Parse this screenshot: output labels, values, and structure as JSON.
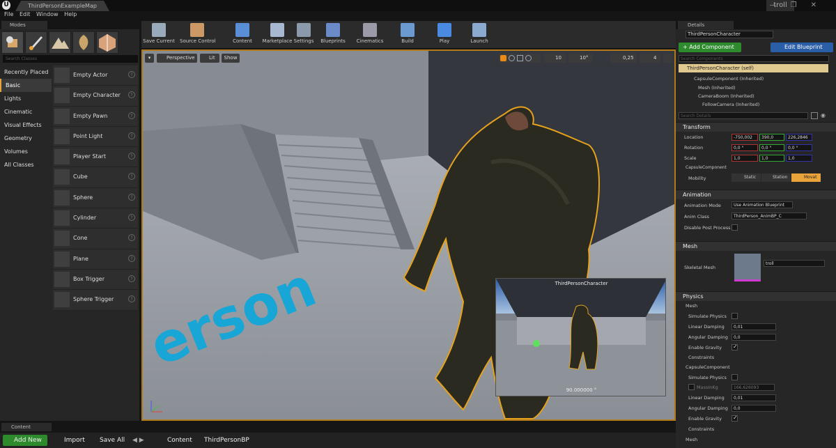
{
  "window": {
    "title": "ThirdPersonExampleMap",
    "user": "troll",
    "controls": [
      "—",
      "❐",
      "✕"
    ]
  },
  "menu": [
    "File",
    "Edit",
    "Window",
    "Help"
  ],
  "modes": {
    "tab": "Modes",
    "search_placeholder": "Search Classes",
    "categories": [
      "Recently Placed",
      "Basic",
      "Lights",
      "Cinematic",
      "Visual Effects",
      "Geometry",
      "Volumes",
      "All Classes"
    ],
    "selected_category": "Basic",
    "classes": [
      "Empty Actor",
      "Empty Character",
      "Empty Pawn",
      "Point Light",
      "Player Start",
      "Cube",
      "Sphere",
      "Cylinder",
      "Cone",
      "Plane",
      "Box Trigger",
      "Sphere Trigger"
    ]
  },
  "toolbar": [
    {
      "label": "Save Current",
      "icon": "save-icon"
    },
    {
      "label": "Source Control",
      "icon": "source-control-icon"
    },
    {
      "label": "Content",
      "icon": "content-icon"
    },
    {
      "label": "Marketplace",
      "icon": "marketplace-icon"
    },
    {
      "label": "Settings",
      "icon": "settings-icon"
    },
    {
      "label": "Blueprints",
      "icon": "blueprints-icon"
    },
    {
      "label": "Cinematics",
      "icon": "cinematics-icon"
    },
    {
      "label": "Build",
      "icon": "build-icon"
    },
    {
      "label": "Play",
      "icon": "play-icon"
    },
    {
      "label": "Launch",
      "icon": "launch-icon"
    }
  ],
  "viewport": {
    "perspective": "Perspective",
    "lit": "Lit",
    "show": "Show",
    "grid_snap": "10",
    "rot_snap": "10°",
    "scale_snap": "0,25",
    "camera_speed": "4",
    "floor_text": "erson",
    "preview_title": "ThirdPersonCharacter",
    "preview_footer": "90.000000 °"
  },
  "content_browser": {
    "tab": "Content Browser",
    "add_new": "Add New",
    "import": "Import",
    "save_all": "Save All",
    "path": [
      "Content",
      "ThirdPersonBP"
    ]
  },
  "details": {
    "tab": "Details",
    "actor_name": "ThirdPersonCharacter",
    "add_component": "+ Add Component",
    "edit_blueprint": "Edit Blueprint",
    "search_components": "Search Components",
    "components": [
      "ThirdPersonCharacter (self)",
      "CapsuleComponent (Inherited)",
      "Mesh (Inherited)",
      "CameraBoom (Inherited)",
      "FollowCamera (Inherited)"
    ],
    "search_details": "Search Details",
    "transform": {
      "title": "Transform",
      "location_label": "Location",
      "location": [
        "-750,002",
        "390,0",
        "226,2846"
      ],
      "rotation_label": "Rotation",
      "rotation": [
        "0,0 °",
        "0,0 °",
        "0,0 °"
      ],
      "scale_label": "Scale",
      "scale": [
        "1,0",
        "1,0",
        "1,0"
      ],
      "capsule_label": "CapsuleComponent",
      "mobility_label": "Mobility",
      "mobility": [
        "Static",
        "Station",
        "Movat"
      ]
    },
    "animation": {
      "title": "Animation",
      "mode_label": "Animation Mode",
      "mode": "Use Animation Blueprint",
      "class_label": "Anim Class",
      "class": "ThirdPerson_AnimBP_C",
      "disable_label": "Disable Post Process"
    },
    "mesh": {
      "title": "Mesh",
      "skeletal_label": "Skeletal Mesh",
      "skeletal": "troll"
    },
    "physics": {
      "title": "Physics",
      "mesh_sub": "Mesh",
      "simulate": "Simulate Physics",
      "linear": "Linear Damping",
      "linear_val": "0,01",
      "angular": "Angular Damping",
      "angular_val": "0,0",
      "gravity": "Enable Gravity",
      "constraints": "Constraints",
      "capsule_sub": "CapsuleComponent",
      "mass_label": "MassInKg",
      "mass": "166,626093",
      "linear_val2": "0,01",
      "angular_val2": "0,0",
      "mesh_sub2": "Mesh"
    }
  }
}
